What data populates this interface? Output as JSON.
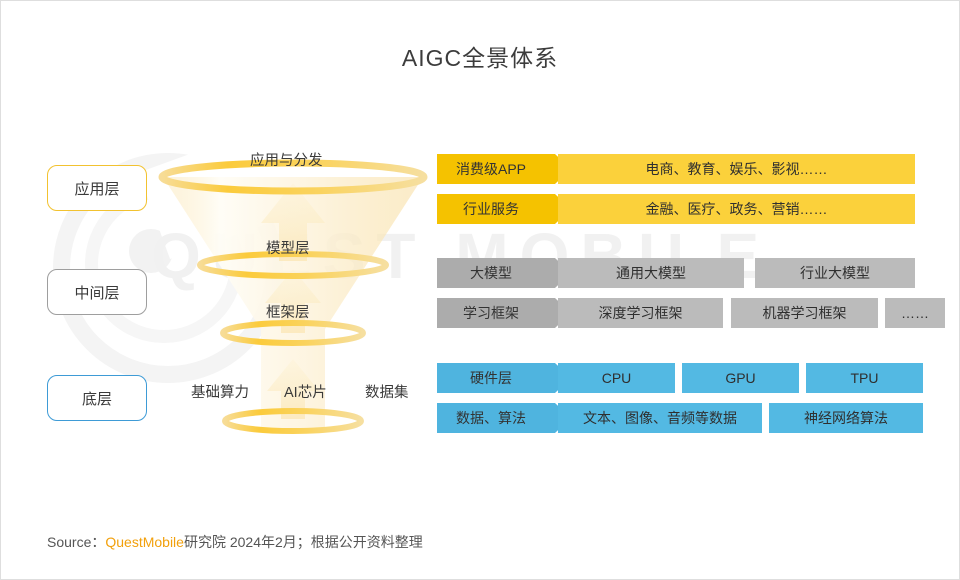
{
  "title": "AIGC全景体系",
  "layers": [
    {
      "name": "应用层",
      "accent": "#F2C230"
    },
    {
      "name": "中间层",
      "accent": "#9E9E9E"
    },
    {
      "name": "底层",
      "accent": "#3E9BD6"
    }
  ],
  "funnel": {
    "stage_app": "应用与分发",
    "stage_model": "模型层",
    "stage_framework": "框架层",
    "base_1": "基础算力",
    "base_2": "AI芯片",
    "base_3": "数据集"
  },
  "rows": {
    "app_apps": {
      "tag": "消费级APP",
      "cells": [
        "电商、教育、娱乐、影视……"
      ]
    },
    "app_industry": {
      "tag": "行业服务",
      "cells": [
        "金融、医疗、政务、营销……"
      ]
    },
    "mid_models": {
      "tag": "大模型",
      "cells": [
        "通用大模型",
        "行业大模型"
      ]
    },
    "mid_frameworks": {
      "tag": "学习框架",
      "cells": [
        "深度学习框架",
        "机器学习框架",
        "……"
      ]
    },
    "base_hardware": {
      "tag": "硬件层",
      "cells": [
        "CPU",
        "GPU",
        "TPU"
      ]
    },
    "base_data": {
      "tag": "数据、算法",
      "cells": [
        "文本、图像、音频等数据",
        "神经网络算法"
      ]
    }
  },
  "watermark": {
    "text": "QUEST MOBILE"
  },
  "footer": {
    "prefix": "Source：",
    "brand": "QuestMobile",
    "rest": "研究院 2024年2月；根据公开资料整理"
  },
  "colors": {
    "tag_yellow": "#F5C200",
    "cell_yellow": "#FBD13B",
    "tag_gray": "#ACACAC",
    "cell_gray": "#BBBBBB",
    "tag_blue": "#4FB4DF",
    "cell_blue": "#53B9E3",
    "brand_orange": "#F2A00C"
  }
}
